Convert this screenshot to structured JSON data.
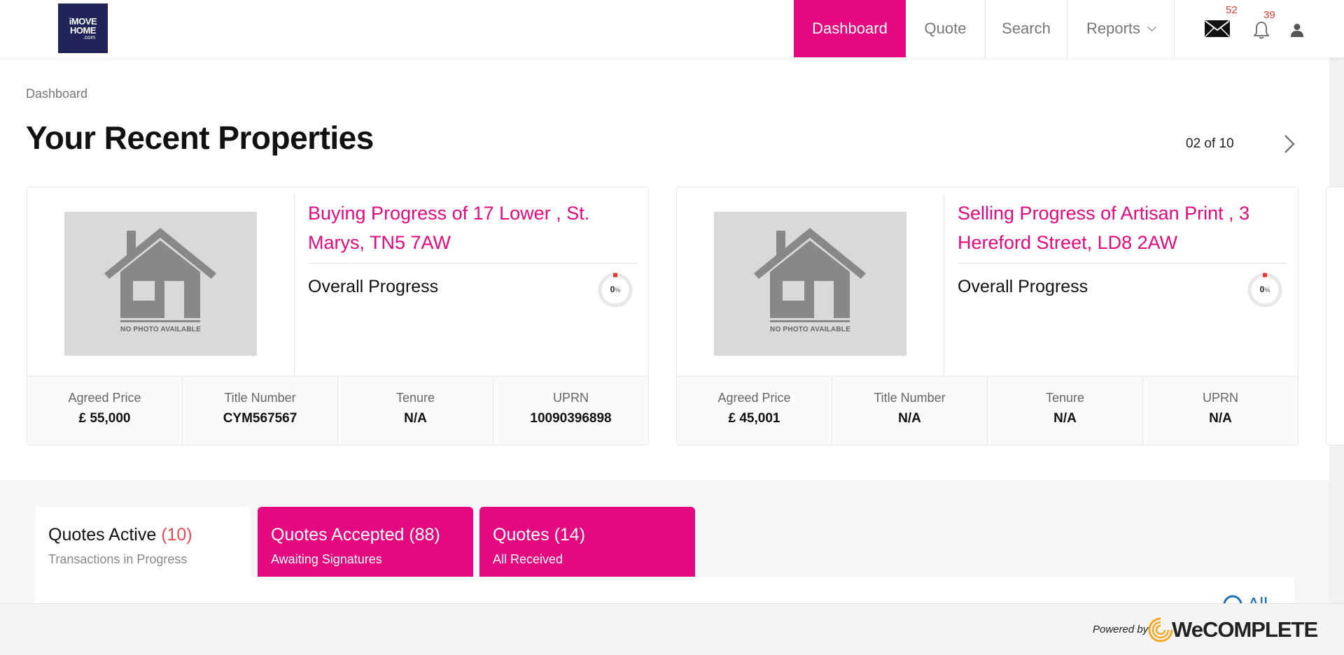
{
  "header": {
    "logo": {
      "line1": "iMOVE",
      "line2": "HOME",
      "line3": ".com"
    },
    "nav": [
      {
        "label": "Dashboard"
      },
      {
        "label": "Quote"
      },
      {
        "label": "Search"
      },
      {
        "label": "Reports"
      }
    ],
    "mail_count": "52",
    "notification_count": "39"
  },
  "breadcrumb": "Dashboard",
  "page_title": "Your Recent Properties",
  "pager": "02 of 10",
  "cards": [
    {
      "photo_text": "NO PHOTO AVAILABLE",
      "title": "Buying Progress of 17 Lower , St. Marys, TN5 7AW",
      "progress_label": "Overall Progress",
      "progress_value": "0",
      "progress_unit": "%",
      "progress_fraction": 0,
      "stats": [
        {
          "label": "Agreed Price",
          "value": "£ 55,000"
        },
        {
          "label": "Title Number",
          "value": "CYM567567"
        },
        {
          "label": "Tenure",
          "value": "N/A"
        },
        {
          "label": "UPRN",
          "value": "10090396898"
        }
      ]
    },
    {
      "photo_text": "NO PHOTO AVAILABLE",
      "title": "Selling Progress of Artisan Print , 3 Hereford Street, LD8 2AW",
      "progress_label": "Overall Progress",
      "progress_value": "0",
      "progress_unit": "%",
      "progress_fraction": 0,
      "stats": [
        {
          "label": "Agreed Price",
          "value": "£ 45,001"
        },
        {
          "label": "Title Number",
          "value": "N/A"
        },
        {
          "label": "Tenure",
          "value": "N/A"
        },
        {
          "label": "UPRN",
          "value": "N/A"
        }
      ]
    }
  ],
  "tabs": [
    {
      "title": "Quotes Active",
      "count": "(10)",
      "subtitle": "Transactions in Progress"
    },
    {
      "title": "Quotes Accepted",
      "count": "(88)",
      "subtitle": "Awaiting Signatures"
    },
    {
      "title": "Quotes",
      "count": "(14)",
      "subtitle": "All Received"
    }
  ],
  "panel_all_label": "All",
  "footer": {
    "powered_by": "Powered by",
    "brand": "WeCOMPLETE"
  },
  "colors": {
    "brand_pink": "#e5097f",
    "navy": "#1f2357",
    "badge_red": "#e53935",
    "link_blue": "#1e6eb5"
  }
}
